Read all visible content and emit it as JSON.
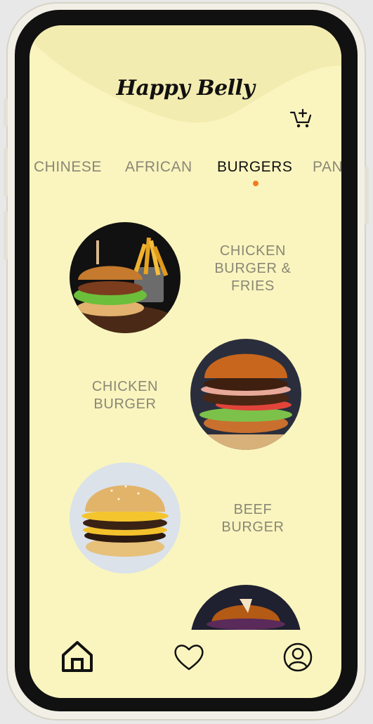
{
  "app": {
    "title": "Happy Belly"
  },
  "header": {
    "cart_icon": "cart-plus-icon"
  },
  "tabs": [
    {
      "label": "CHINESE",
      "active": false
    },
    {
      "label": "AFRICAN",
      "active": false
    },
    {
      "label": "BURGERS",
      "active": true
    },
    {
      "label": "PAN",
      "active": false
    }
  ],
  "menu": [
    {
      "name_lines": [
        "CHICKEN",
        "BURGER &",
        "FRIES"
      ]
    },
    {
      "name_lines": [
        "CHICKEN",
        "BURGER"
      ]
    },
    {
      "name_lines": [
        "BEEF",
        "BURGER"
      ]
    }
  ],
  "nav": {
    "home_icon": "home-icon",
    "favorites_icon": "heart-icon",
    "profile_icon": "user-icon"
  },
  "colors": {
    "background": "#faf5bf",
    "accent": "#f47a20",
    "muted_text": "#8a8775",
    "text": "#111111"
  }
}
